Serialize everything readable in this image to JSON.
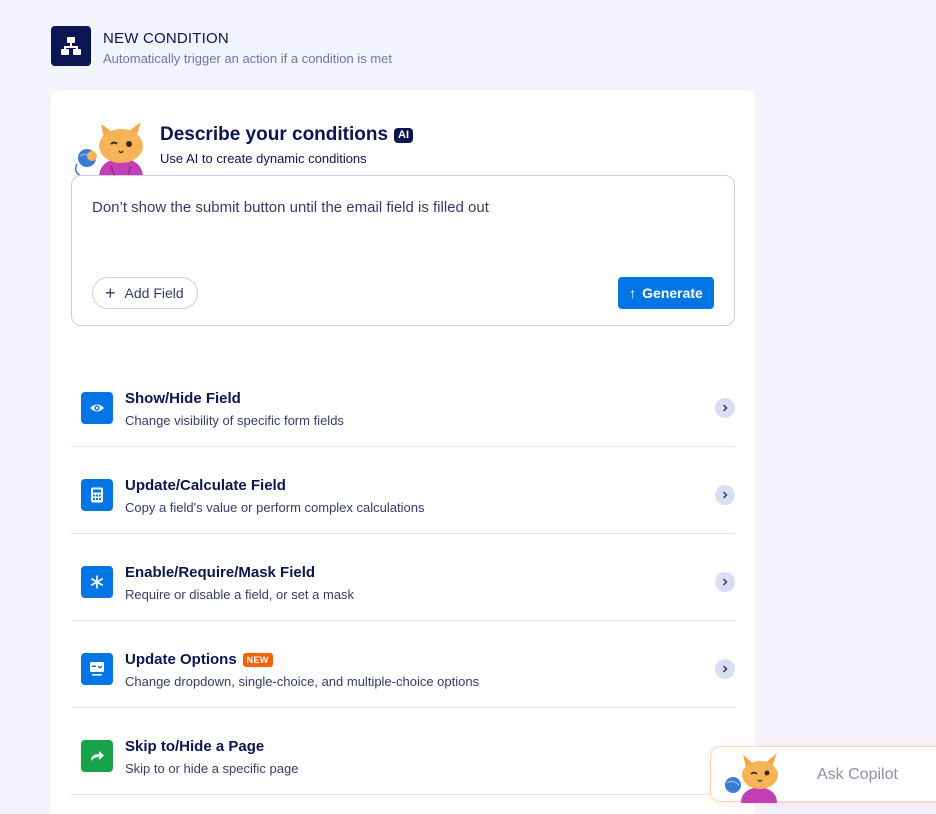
{
  "header": {
    "title": "NEW CONDITION",
    "subtitle": "Automatically trigger an action if a condition is met",
    "icon": "hierarchy-icon"
  },
  "ai": {
    "title": "Describe your conditions",
    "badge": "AI",
    "subtitle": "Use AI to create dynamic conditions",
    "prompt_value": "Don’t show the submit button until the email field is filled out",
    "add_field_label": "Add Field",
    "generate_label": "Generate"
  },
  "options": [
    {
      "title": "Show/Hide Field",
      "description": "Change visibility of specific form fields",
      "icon": "eye-icon",
      "color": "#0075e3",
      "badge": ""
    },
    {
      "title": "Update/Calculate Field",
      "description": "Copy a field's value or perform complex calculations",
      "icon": "calculator-icon",
      "color": "#0075e3",
      "badge": ""
    },
    {
      "title": "Enable/Require/Mask Field",
      "description": "Require or disable a field, or set a mask",
      "icon": "asterisk-icon",
      "color": "#0075e3",
      "badge": ""
    },
    {
      "title": "Update Options",
      "description": "Change dropdown, single-choice, and multiple-choice options",
      "icon": "options-icon",
      "color": "#0075e3",
      "badge": "NEW"
    },
    {
      "title": "Skip to/Hide a Page",
      "description": "Skip to or hide a specific page",
      "icon": "redirect-arrow-icon",
      "color": "#18a34a",
      "badge": ""
    }
  ],
  "copilot": {
    "label": "Ask Copilot"
  },
  "colors": {
    "navy": "#0a1551",
    "primary_blue": "#0075e3",
    "green": "#18a34a",
    "new_badge_orange": "#ff6100",
    "background": "#f3f3fe"
  }
}
